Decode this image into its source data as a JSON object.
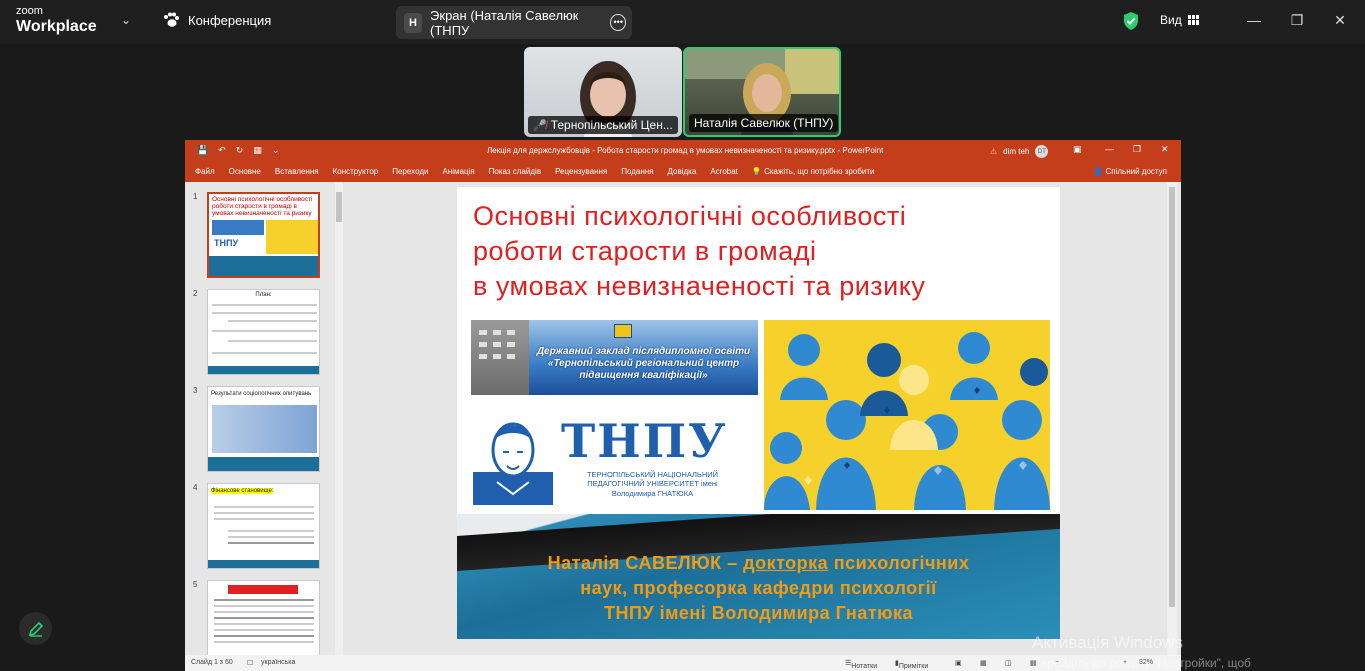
{
  "zoom": {
    "logo_top": "zoom",
    "logo_bottom": "Workplace",
    "conference_label": "Конференция",
    "screen_share_avatar": "Н",
    "screen_share_label": "Экран (Наталія Савелюк (ТНПУ",
    "view_label": "Вид",
    "participants": [
      {
        "name": "Тернопільський Цен...",
        "muted": true
      },
      {
        "name": "Наталія Савелюк (ТНПУ)",
        "muted": false
      }
    ],
    "colors": {
      "active_speaker": "#2ecc71",
      "shield": "#2ecc71"
    }
  },
  "ppt": {
    "window_title": "Лекція для держслужбовців - Робота старости громад в умовах невизначеності та ризику.pptx  -  PowerPoint",
    "user_name": "dim teh",
    "user_initials": "DT",
    "menu": [
      "Файл",
      "Основне",
      "Вставлення",
      "Конструктор",
      "Переходи",
      "Анімація",
      "Показ слайдів",
      "Рецензування",
      "Подання",
      "Довідка",
      "Acrobat"
    ],
    "tell_me": "Скажіть, що потрібно зробити",
    "share": "Спільний доступ",
    "thumbnails": [
      {
        "num": "1",
        "title": "Основні психологічні особливості роботи старости в громаді в умовах невизначеності та ризику"
      },
      {
        "num": "2",
        "title": "План:"
      },
      {
        "num": "3",
        "title": "Результати соціологічних опитувань"
      },
      {
        "num": "4",
        "title": "Фінансове становище:"
      },
      {
        "num": "5",
        "title": ""
      }
    ],
    "slide": {
      "title_lines": [
        "Основні психологічні особливості",
        "роботи старости в громаді",
        "в умовах невизначеності та ризику"
      ],
      "banner_text": "Державний заклад післядипломної освіти «Тернопільський регіональний центр підвищення кваліфікації»",
      "logo": "ТНПУ",
      "logo_sub": "ТЕРНОПІЛЬСЬКИЙ НАЦІОНАЛЬНИЙ ПЕДАГОГІЧНИЙ УНІВЕРСИТЕТ імені Володимира ГНАТЮКА",
      "author_pre": "Наталія САВЕЛЮК – ",
      "author_underlined": "докторка",
      "author_post": " психологічних",
      "author_line2": "наук, професорка кафедри психології",
      "author_line3": "ТНПУ імені Володимира Гнатюка"
    },
    "status": {
      "slide_counter": "Слайд 1 з 60",
      "language": "українська",
      "notes": "Нотатки",
      "comments": "Примітки",
      "zoom": "82%"
    },
    "colors": {
      "accent": "#c43e1c",
      "title_red": "#e02020",
      "author_orange": "#f39c12",
      "logo_blue": "#1f5fae"
    }
  },
  "windows": {
    "activate_title": "Активація Windows",
    "activate_hint": "Перейдіть до розділу \"Настройки\", щоб"
  }
}
